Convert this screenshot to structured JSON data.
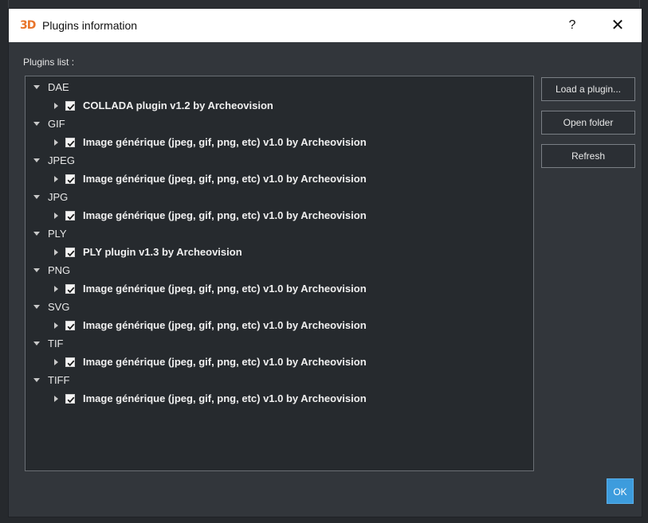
{
  "window": {
    "title": "Plugins information",
    "logo_text": "3D",
    "help_label": "?",
    "close_label": "✕"
  },
  "list_label": "Plugins list :",
  "groups": [
    {
      "ext": "DAE",
      "plugin": "COLLADA plugin v1.2 by Archeovision",
      "checked": true
    },
    {
      "ext": "GIF",
      "plugin": "Image générique (jpeg, gif, png, etc) v1.0 by Archeovision",
      "checked": true
    },
    {
      "ext": "JPEG",
      "plugin": "Image générique (jpeg, gif, png, etc) v1.0 by Archeovision",
      "checked": true
    },
    {
      "ext": "JPG",
      "plugin": "Image générique (jpeg, gif, png, etc) v1.0 by Archeovision",
      "checked": true
    },
    {
      "ext": "PLY",
      "plugin": "PLY plugin v1.3 by Archeovision",
      "checked": true
    },
    {
      "ext": "PNG",
      "plugin": "Image générique (jpeg, gif, png, etc) v1.0 by Archeovision",
      "checked": true
    },
    {
      "ext": "SVG",
      "plugin": "Image générique (jpeg, gif, png, etc) v1.0 by Archeovision",
      "checked": true
    },
    {
      "ext": "TIF",
      "plugin": "Image générique (jpeg, gif, png, etc) v1.0 by Archeovision",
      "checked": true
    },
    {
      "ext": "TIFF",
      "plugin": "Image générique (jpeg, gif, png, etc) v1.0 by Archeovision",
      "checked": true
    }
  ],
  "buttons": {
    "load": "Load a plugin...",
    "open": "Open folder",
    "refresh": "Refresh",
    "ok": "OK"
  },
  "colors": {
    "background": "#32363b",
    "tree_background": "#262a2e",
    "accent": "#3d9cdd",
    "logo": "#e8742a"
  },
  "icons": [
    "app-logo-icon",
    "help-icon",
    "close-icon",
    "caret-down-icon",
    "caret-right-icon",
    "checkbox-checked-icon"
  ]
}
